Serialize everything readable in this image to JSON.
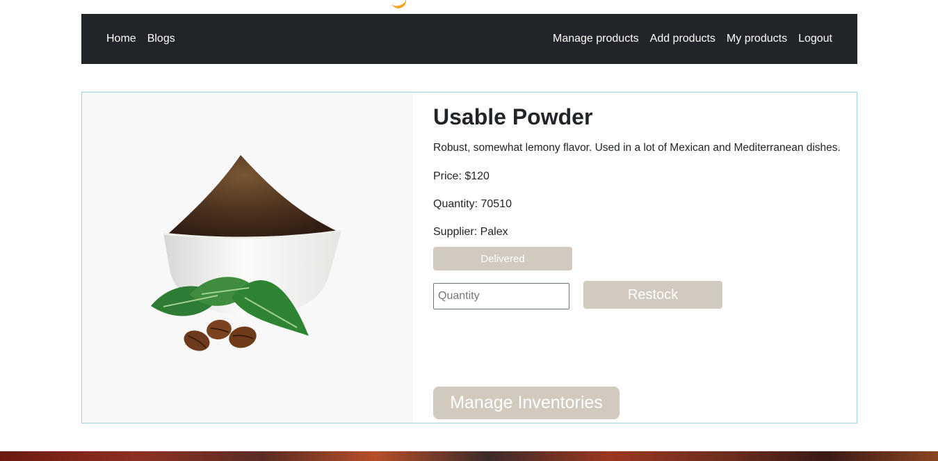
{
  "nav": {
    "left_links": [
      "Home",
      "Blogs"
    ],
    "right_links": [
      "Manage products",
      "Add products",
      "My products",
      "Logout"
    ]
  },
  "product": {
    "name": "Usable Powder",
    "description": "Robust, somewhat lemony flavor. Used in a lot of Mexican and Mediterranean dishes.",
    "price_text": "Price: $120",
    "quantity_text": "Quantity: 70510",
    "supplier_text": "Supplier: Palex",
    "image_icon": "coffee-powder-bowl-image"
  },
  "actions": {
    "delivered_label": "Delivered",
    "quantity_placeholder": "Quantity",
    "quantity_value": "",
    "restock_label": "Restock",
    "manage_inventories_label": "Manage Inventories"
  },
  "colors": {
    "navbar_bg": "#212529",
    "button_bg": "#d2c9bf",
    "card_border": "#9fd0ea"
  }
}
